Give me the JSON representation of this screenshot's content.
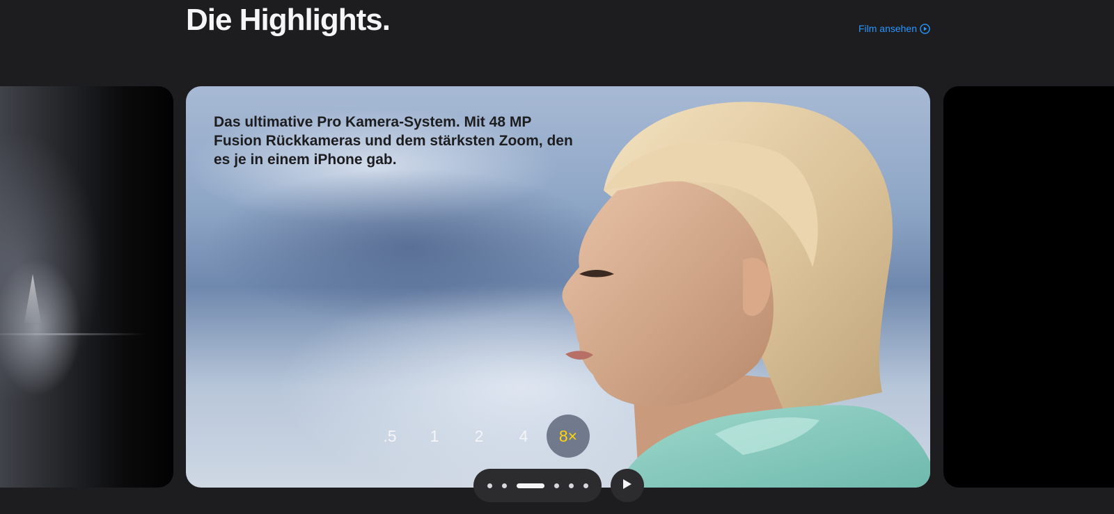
{
  "header": {
    "title": "Die Highlights.",
    "film_link_label": "Film ansehen",
    "film_link_icon": "play-circle-icon",
    "accent_color": "#2997ff"
  },
  "carousel": {
    "active_card": {
      "headline": "Das ultimative Pro Kamera-System. Mit 48 MP Fusion Rückkameras und dem stärksten Zoom, den es je in einem iPhone gab.",
      "zoom_options": [
        ".5",
        "1",
        "2",
        "4",
        "8×"
      ],
      "selected_zoom": "8×",
      "selected_zoom_color": "#ffd60a"
    },
    "pagination": {
      "total": 6,
      "active_index": 2
    },
    "play_button_icon": "play-icon"
  }
}
